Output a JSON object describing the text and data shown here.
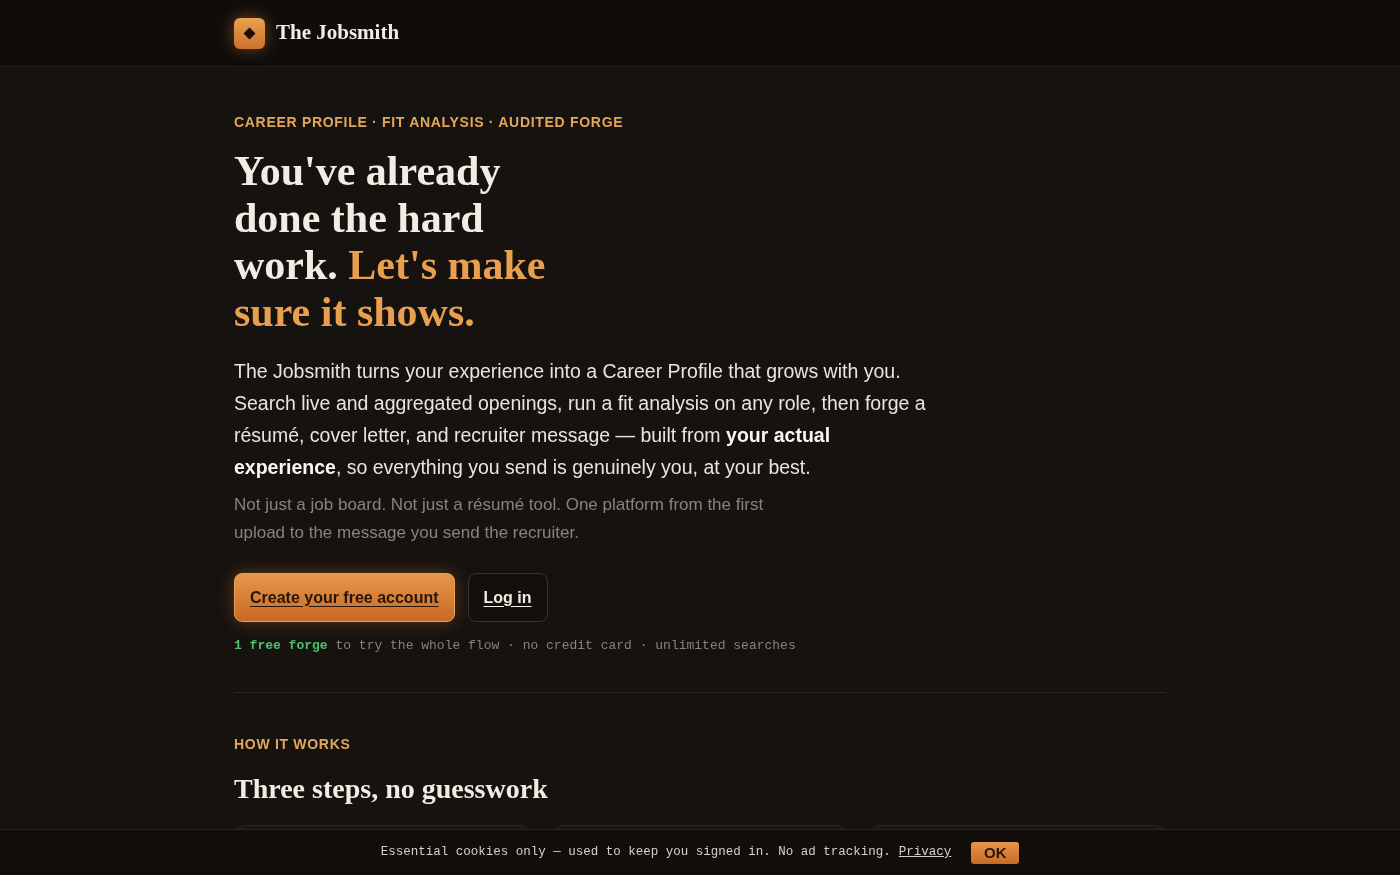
{
  "header": {
    "brand": "The Jobsmith"
  },
  "hero": {
    "eyebrow": "CAREER PROFILE · FIT ANALYSIS · AUDITED FORGE",
    "headline": "You've already done the hard work.",
    "headline_accent": "Let's make sure it shows.",
    "intro": "The Jobsmith turns your experience into a Career Profile that grows with you. Search live and aggregated openings, run a fit analysis on any role, then forge a résumé, cover letter, and recruiter message — built from **your actual experience**, so everything you send is genuinely you, at your best.",
    "note": "Not just a job board. Not just a résumé tool. One platform from the first upload to the message you send the recruiter.",
    "buttons": [
      {
        "kind": "primary",
        "label": "Create your free account"
      },
      {
        "kind": "secondary",
        "label": "Log in"
      }
    ],
    "fine_print": "**1 free forge** to try the whole flow · no credit card · unlimited searches"
  },
  "how_it_works": {
    "eyebrow": "HOW IT WORKS",
    "title": "Three steps, no guesswork"
  },
  "cookie_banner": {
    "text": "Essential cookies only — used to keep you signed in. No ad tracking.",
    "link": "Privacy",
    "button": "OK"
  }
}
